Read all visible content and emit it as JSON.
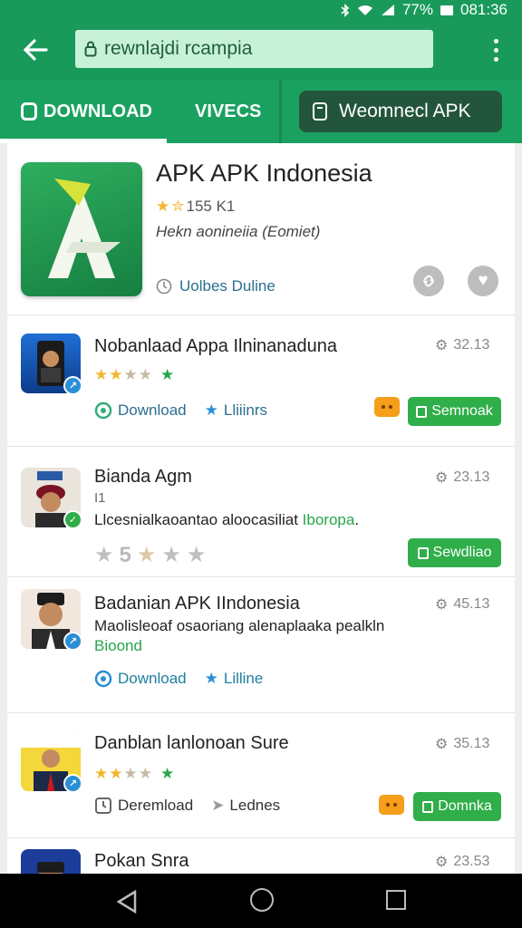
{
  "status_bar": {
    "battery": "77%",
    "time": "081:36"
  },
  "toolbar": {
    "url": "rewnlajdi rcampia"
  },
  "tabs": {
    "download": "DOWNLOAD",
    "vives": "VIVECS",
    "action_button": "Weomnecl APK"
  },
  "featured": {
    "title": "APK APK Indonesia",
    "rating_text": "155 K1",
    "subtitle": "Hekn aonineiia (Eomiet)",
    "meta": "Uolbes Duline"
  },
  "items": [
    {
      "title": "Nobanlaad Appa Ilninanaduna",
      "time": "32.13",
      "link1": "Download",
      "link2": "Lliiinrs",
      "button": "Semnoak"
    },
    {
      "title": "Bianda Agm",
      "time": "23.13",
      "line2": "I1",
      "desc": "Llcesnialkaoantao aloocasiliat ",
      "desc_green": "Iboropa",
      "desc_tail": ".",
      "big_rating": "5",
      "button": "Sewdliao"
    },
    {
      "title": "Badanian APK IIndonesia",
      "time": "45.13",
      "desc": "Maolisleoaf osaoriang alenaplaaka pealkln",
      "desc_green": "Bioond",
      "link1": "Download",
      "link2": "Lilline"
    },
    {
      "title": "Danblan lanlonoan Sure",
      "time": "35.13",
      "link1": "Deremload",
      "link2": "Lednes",
      "button": "Domnka"
    },
    {
      "title": "Pokan Snra",
      "time": "23.53"
    }
  ],
  "colors": {
    "primary": "#199a5b",
    "accent_green": "#2fae49",
    "star": "#f2b72c"
  }
}
